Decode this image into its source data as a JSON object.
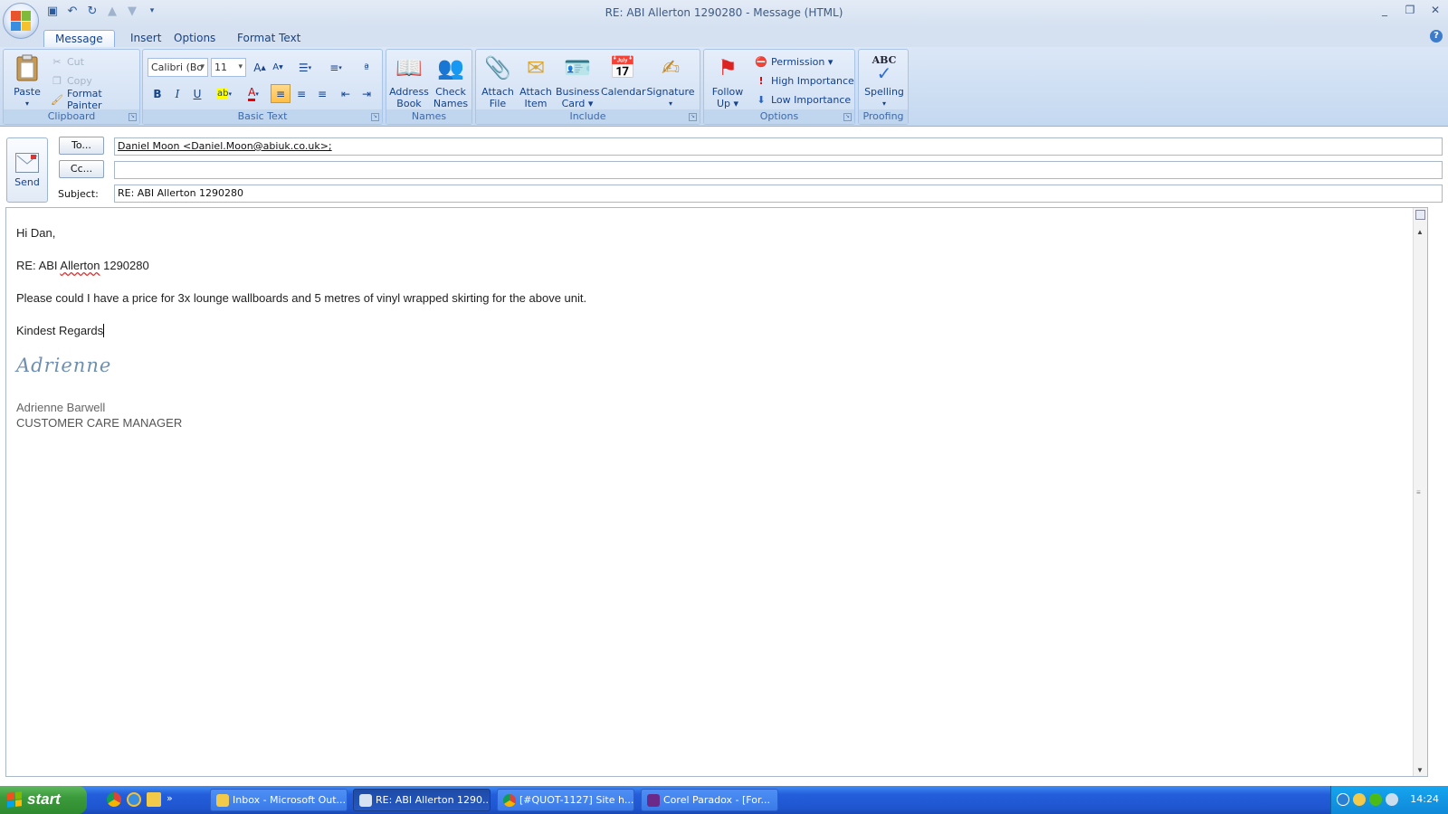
{
  "window": {
    "title": "RE: ABI Allerton 1290280 - Message (HTML)",
    "controls": {
      "minimize": "_",
      "restore": "❐",
      "close": "✕"
    }
  },
  "tabs": [
    "Message",
    "Insert",
    "Options",
    "Format Text"
  ],
  "help": "?",
  "ribbon": {
    "clipboard": {
      "label": "Clipboard",
      "paste": "Paste",
      "cut": "Cut",
      "copy": "Copy",
      "format_painter": "Format Painter"
    },
    "basic_text": {
      "label": "Basic Text",
      "font_name": "Calibri (Bo",
      "font_size": "11"
    },
    "names": {
      "label": "Names",
      "address_book": [
        "Address",
        "Book"
      ],
      "check_names": [
        "Check",
        "Names"
      ]
    },
    "include": {
      "label": "Include",
      "attach_file": [
        "Attach",
        "File"
      ],
      "attach_item": [
        "Attach",
        "Item"
      ],
      "business_card": [
        "Business",
        "Card ▾"
      ],
      "calendar": "Calendar",
      "signature": [
        "Signature",
        "▾"
      ]
    },
    "options": {
      "label": "Options",
      "follow_up": [
        "Follow",
        "Up ▾"
      ],
      "permission": "Permission ▾",
      "high_importance": "High Importance",
      "low_importance": "Low Importance"
    },
    "proofing": {
      "label": "Proofing",
      "spelling": "Spelling",
      "spelling_icon_text": "ABC"
    }
  },
  "header": {
    "send": "Send",
    "to_button": "To...",
    "cc_button": "Cc...",
    "subject_label": "Subject:",
    "to_value": "Daniel Moon <Daniel.Moon@abiuk.co.uk>;",
    "cc_value": "",
    "subject_value": "RE: ABI Allerton 1290280"
  },
  "body": {
    "greeting": "Hi Dan,",
    "ref_prefix": "RE: ABI ",
    "ref_word": "Allerton",
    "ref_suffix": " 1290280",
    "paragraph": "Please could I have a price for 3x lounge wallboards and 5 metres of vinyl wrapped skirting for the above unit.",
    "closing": "Kindest Regards",
    "signature_script": "Adrienne",
    "sig_name": "Adrienne Barwell",
    "sig_title": "CUSTOMER CARE MANAGER"
  },
  "taskbar": {
    "start": "start",
    "items": [
      "Inbox - Microsoft Out...",
      "RE: ABI Allerton 1290...",
      "[#QUOT-1127] Site h...",
      "Corel Paradox - [For..."
    ],
    "clock": "14:24"
  },
  "colors": {
    "ribbon_bg": "#c4d8f0",
    "accent": "#15428b",
    "taskbar": "#245edb",
    "start_green": "#3b9b3b"
  }
}
